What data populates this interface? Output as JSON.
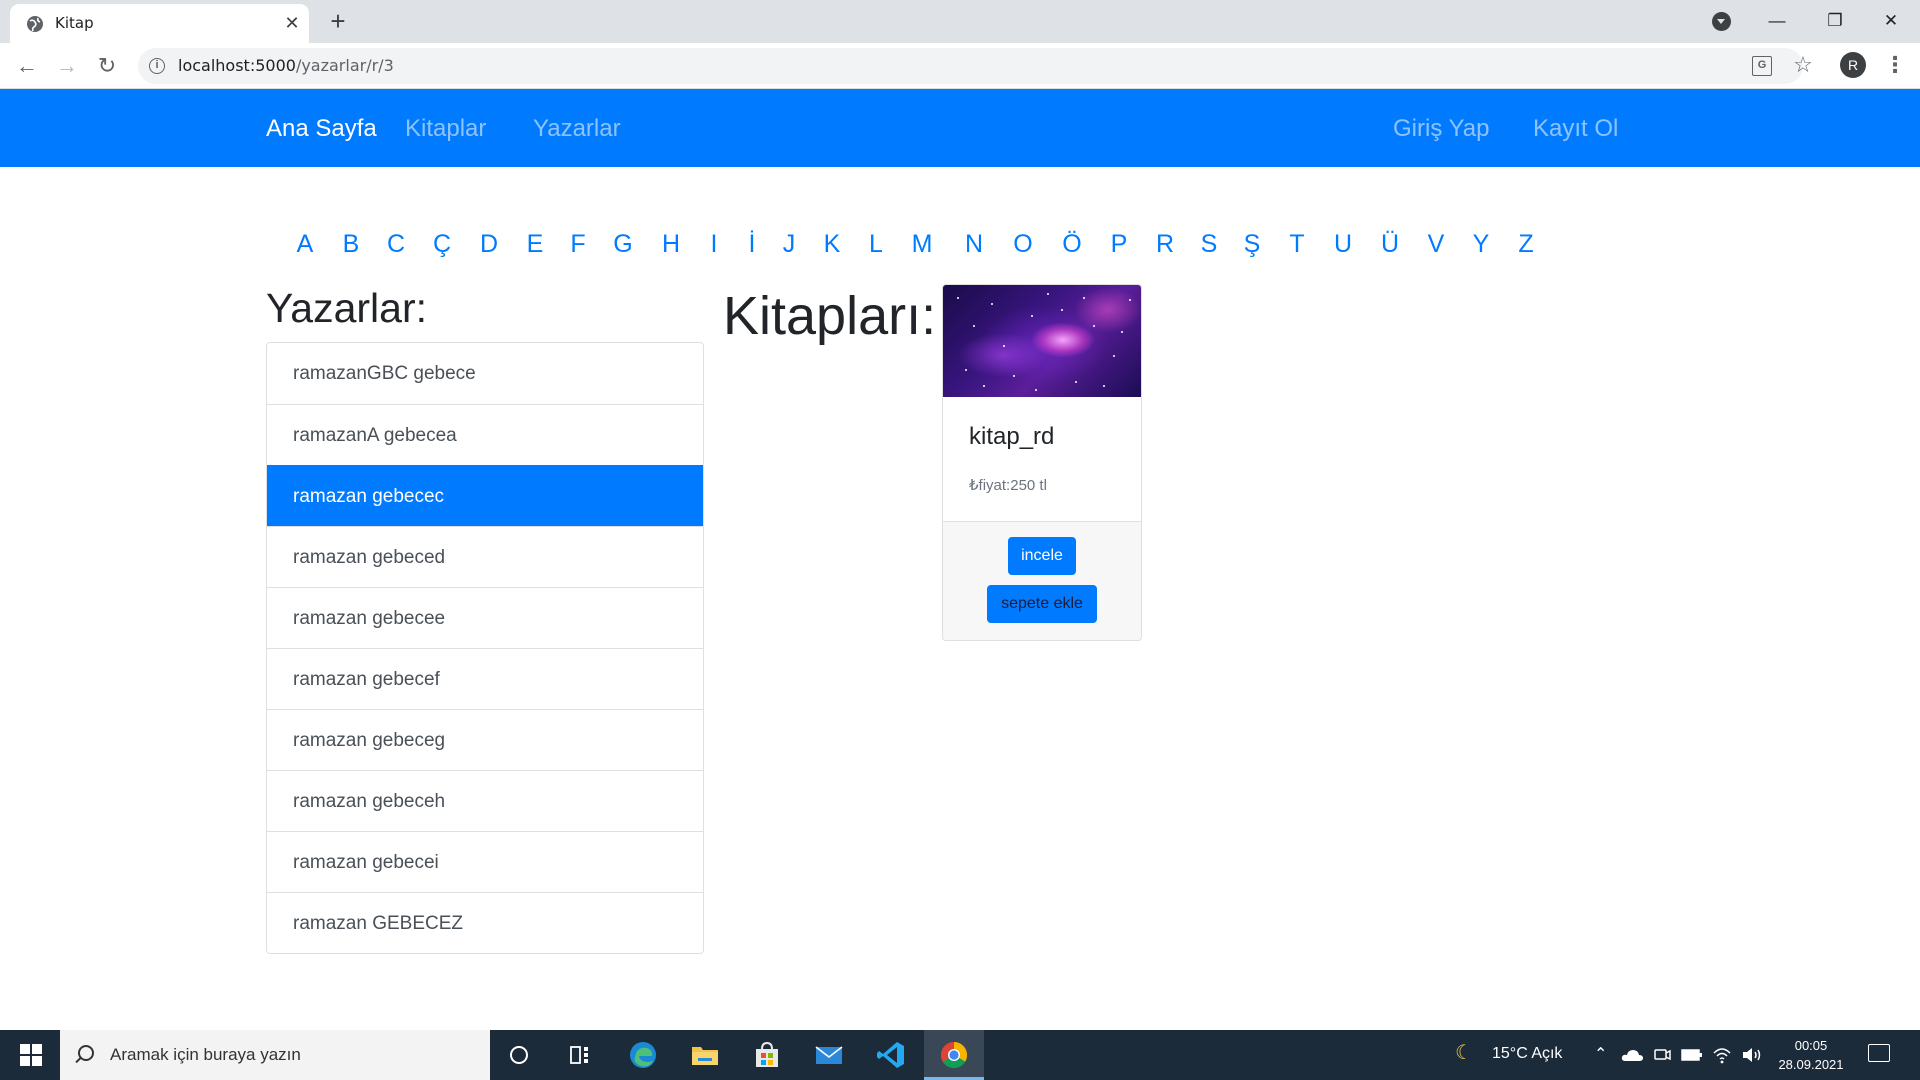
{
  "browser": {
    "tab_title": "Kitap",
    "url_host": "localhost:5000",
    "url_path": "/yazarlar/r/3",
    "profile_initial": "R"
  },
  "navbar": {
    "brand": "Ana Sayfa",
    "links": [
      "Kitaplar",
      "Yazarlar"
    ],
    "auth_links": [
      "Giriş Yap",
      "Kayıt Ol"
    ]
  },
  "alphabet": [
    "A",
    "B",
    "C",
    "Ç",
    "D",
    "E",
    "F",
    "G",
    "H",
    "I",
    "İ",
    "J",
    "K",
    "L",
    "M",
    "N",
    "O",
    "Ö",
    "P",
    "R",
    "S",
    "Ş",
    "T",
    "U",
    "Ü",
    "V",
    "Y",
    "Z"
  ],
  "authors": {
    "heading": "Yazarlar:",
    "items": [
      "ramazanGBC gebece",
      "ramazanA gebecea",
      "ramazan gebecec",
      "ramazan gebeced",
      "ramazan gebecee",
      "ramazan gebecef",
      "ramazan gebeceg",
      "ramazan gebeceh",
      "ramazan gebecei",
      "ramazan GEBECEZ"
    ],
    "active_index": 2
  },
  "books": {
    "heading": "Kitapları:",
    "cards": [
      {
        "title": "kitap_rd",
        "price": "₺fiyat:250 tl",
        "view_label": "incele",
        "cart_label": "sepete ekle"
      }
    ]
  },
  "taskbar": {
    "search_placeholder": "Aramak için buraya yazın",
    "weather": "15°C  Açık",
    "time": "00:05",
    "date": "28.09.2021"
  },
  "colors": {
    "primary": "#007bff",
    "taskbar": "#1c2b3a",
    "tabstrip": "#dee1e6"
  }
}
